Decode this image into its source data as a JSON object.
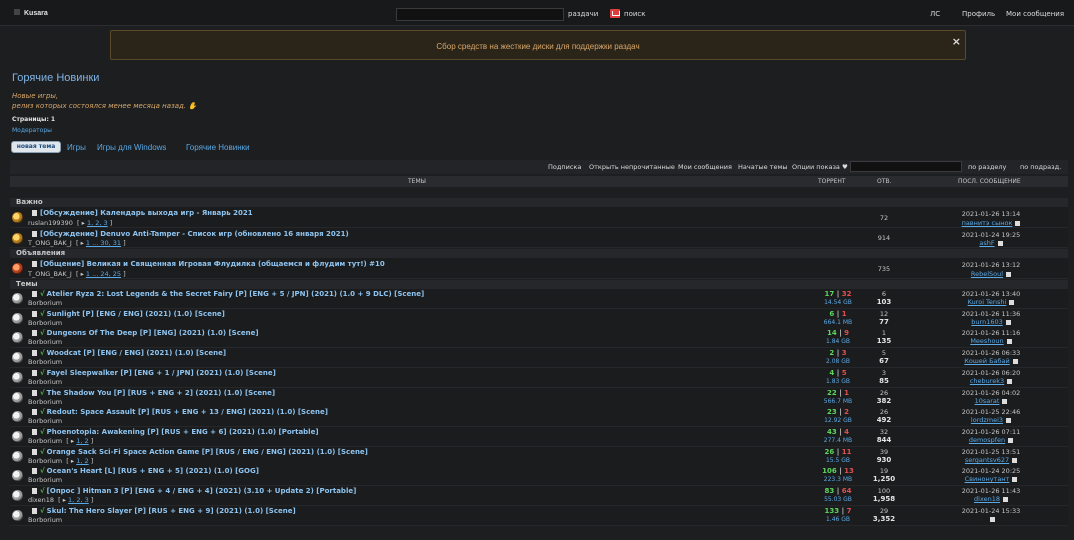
{
  "topbar": {
    "logo": "Kusara",
    "raz_label": "раздачи",
    "search_label": "поиск",
    "nav": [
      "ЛС",
      "Профиль",
      "Мои сообщения"
    ]
  },
  "notice": {
    "text": "Сбор средств на жесткие диски для поддержки раздач",
    "close": "×"
  },
  "page": {
    "title": "Горячие Новинки",
    "desc1": "Новые игры,",
    "desc2": "релиз которых состоялся менее месяца назад.",
    "pages": "Страницы: 1",
    "mods": "Модераторы",
    "new_topic": "новая тема"
  },
  "breadcrumb": [
    "Игры",
    "Игры для Windows",
    "Горячие Новинки"
  ],
  "toolbar": {
    "subscribe": "Подписка",
    "open_unread": "Открыть непрочитанные",
    "my_posts": "Мои сообщения",
    "started": "Начатые темы",
    "options": "Опции показа",
    "by_section": "по разделу",
    "by_subsection": "по подразд."
  },
  "columns": {
    "topics": "ТЕМЫ",
    "torrent": "ТОРРЕНТ",
    "replies": "ОТВ.",
    "last": "ПОСЛ. СООБЩЕНИЕ"
  },
  "sections": {
    "important": "Важно",
    "announcements": "Объявления",
    "topics": "Темы"
  },
  "important_rows": [
    {
      "title": "[Обсуждение] Календарь выхода игр - Январь 2021",
      "author": "ruslan199390",
      "pages": "1, 2, 3",
      "replies": "72",
      "date": "2021-01-26 13:14",
      "user": "павнитэ сынок"
    },
    {
      "title": "[Обсуждение] Denuvo Anti-Tamper - Список игр (обновлено 16 января 2021)",
      "author": "T_ONG_BAK_J",
      "pages": "1 ... 30, 31",
      "replies": "914",
      "date": "2021-01-24 19:25",
      "user": "ashF"
    }
  ],
  "announce_rows": [
    {
      "title": "[Общение] Великая и Священная Игровая Флудилка (общаемся и флудим тут!) #10",
      "author": "T_ONG_BAK_J",
      "pages": "1 ... 24, 25",
      "replies": "735",
      "date": "2021-01-26 13:12",
      "user": "RebelSoul"
    }
  ],
  "topic_rows": [
    {
      "title": "Atelier Ryza 2: Lost Legends & the Secret Fairy [P] [ENG + 5 / JPN] (2021) (1.0 + 9 DLC) [Scene]",
      "author": "Borborium",
      "pages": "",
      "seeds": "17",
      "leech": "32",
      "size": "14.54 GB",
      "replies": "6",
      "views": "103",
      "date": "2021-01-26 13:40",
      "user": "Kuroi Tenshi"
    },
    {
      "title": "Sunlight [P] [ENG / ENG] (2021) (1.0) [Scene]",
      "author": "Borborium",
      "pages": "",
      "seeds": "6",
      "leech": "1",
      "size": "664.1 MB",
      "replies": "12",
      "views": "77",
      "date": "2021-01-26 11:36",
      "user": "burn1603"
    },
    {
      "title": "Dungeons Of The Deep [P] [ENG] (2021) (1.0) [Scene]",
      "author": "Borborium",
      "pages": "",
      "seeds": "14",
      "leech": "9",
      "size": "1.84 GB",
      "replies": "1",
      "views": "135",
      "date": "2021-01-26 11:16",
      "user": "Meeshoun"
    },
    {
      "title": "Woodcat [P] [ENG / ENG] (2021) (1.0) [Scene]",
      "author": "Borborium",
      "pages": "",
      "seeds": "2",
      "leech": "3",
      "size": "2.08 GB",
      "replies": "5",
      "views": "67",
      "date": "2021-01-26 06:33",
      "user": "Кошей Бабай"
    },
    {
      "title": "Fayel Sleepwalker [P] [ENG + 1 / JPN] (2021) (1.0) [Scene]",
      "author": "Borborium",
      "pages": "",
      "seeds": "4",
      "leech": "5",
      "size": "1.83 GB",
      "replies": "3",
      "views": "85",
      "date": "2021-01-26 06:20",
      "user": "cheburek3"
    },
    {
      "title": "The Shadow You [P] [RUS + ENG + 2] (2021) (1.0) [Scene]",
      "author": "Borborium",
      "pages": "",
      "seeds": "22",
      "leech": "1",
      "size": "566.7 MB",
      "replies": "26",
      "views": "382",
      "date": "2021-01-26 04:02",
      "user": "10sarat"
    },
    {
      "title": "Redout: Space Assault [P] [RUS + ENG + 13 / ENG] (2021) (1.0) [Scene]",
      "author": "Borborium",
      "pages": "",
      "seeds": "23",
      "leech": "2",
      "size": "12.92 GB",
      "replies": "26",
      "views": "492",
      "date": "2021-01-25 22:46",
      "user": "lordzmei3"
    },
    {
      "title": "Phoenotopia: Awakening [P] [RUS + ENG + 6] (2021) (1.0) [Portable]",
      "author": "Borborium",
      "pages": "1, 2",
      "seeds": "43",
      "leech": "4",
      "size": "277.4 MB",
      "replies": "32",
      "views": "844",
      "date": "2021-01-26 07:11",
      "user": "demospfen"
    },
    {
      "title": "Orange Sack Sci-Fi Space Action Game [P] [RUS / ENG / ENG] (2021) (1.0) [Scene]",
      "author": "Borborium",
      "pages": "1, 2",
      "seeds": "26",
      "leech": "11",
      "size": "15.5 GB",
      "replies": "39",
      "views": "930",
      "date": "2021-01-25 13:51",
      "user": "sergantsv627"
    },
    {
      "title": "Ocean's Heart [L] [RUS + ENG + 5] (2021) (1.0) [GOG]",
      "author": "Borborium",
      "pages": "",
      "seeds": "106",
      "leech": "13",
      "size": "223.3 MB",
      "replies": "19",
      "views": "1,250",
      "date": "2021-01-24 20:25",
      "user": "Свинонутант"
    },
    {
      "title": "[Опрос ] Hitman 3 [P] [ENG + 4 / ENG + 4] (2021) (3.10 + Update 2) [Portable]",
      "author": "dixen18",
      "pages": "1, 2, 3",
      "seeds": "83",
      "leech": "64",
      "size": "55.03 GB",
      "replies": "100",
      "views": "1,958",
      "date": "2021-01-26 11:43",
      "user": "dixen18"
    },
    {
      "title": "Skul: The Hero Slayer [P] [RUS + ENG + 9] (2021) (1.0) [Scene]",
      "author": "Borborium",
      "pages": "",
      "seeds": "133",
      "leech": "7",
      "size": "1.46 GB",
      "replies": "29",
      "views": "3,352",
      "date": "2021-01-24 15:33",
      "user": ""
    }
  ]
}
